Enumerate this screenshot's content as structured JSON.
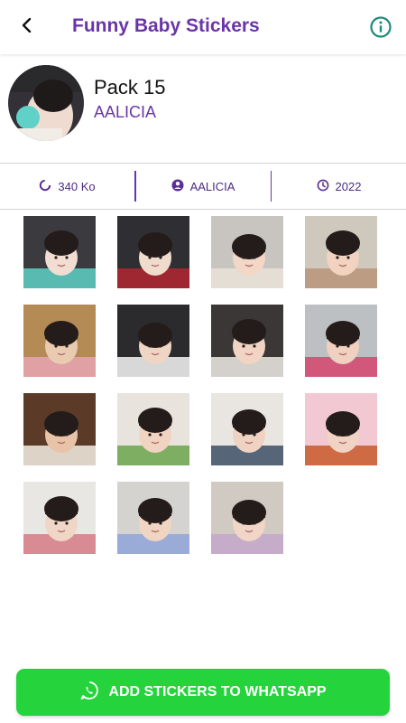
{
  "appbar": {
    "title": "Funny Baby Stickers",
    "back_icon": "back-arrow-icon",
    "info_icon": "info-icon",
    "accent": "#6a35a8"
  },
  "pack": {
    "name": "Pack 15",
    "author": "AALICIA"
  },
  "meta": {
    "size": "340 Ko",
    "author": "AALICIA",
    "year": "2022"
  },
  "stickers": [
    {
      "label": "sticker-1",
      "bg": "#3b3a3f",
      "subject": "#f1ddd2",
      "accent": "#5fd1c7"
    },
    {
      "label": "sticker-2",
      "bg": "#2f2f33",
      "subject": "#f0dccd",
      "accent": "#b32631"
    },
    {
      "label": "sticker-3",
      "bg": "#c8c5c1",
      "subject": "#f2d6c6",
      "accent": "#e9e2d8"
    },
    {
      "label": "sticker-4",
      "bg": "#cfc8bd",
      "subject": "#f1d3c0",
      "accent": "#b89478"
    },
    {
      "label": "sticker-5",
      "bg": "#b48a55",
      "subject": "#e9cbb2",
      "accent": "#e8a4b4"
    },
    {
      "label": "sticker-6",
      "bg": "#2b2b2d",
      "subject": "#efd5c4",
      "accent": "#f7f7f7"
    },
    {
      "label": "sticker-7",
      "bg": "#3a3736",
      "subject": "#f1d4c3",
      "accent": "#f0ece6"
    },
    {
      "label": "sticker-8",
      "bg": "#bcc0c3",
      "subject": "#f0d0c0",
      "accent": "#d5456e"
    },
    {
      "label": "sticker-9",
      "bg": "#5b3b28",
      "subject": "#e8c3a7",
      "accent": "#f6eee3"
    },
    {
      "label": "sticker-10",
      "bg": "#e8e3dc",
      "subject": "#f1d3c1",
      "accent": "#6aa54b"
    },
    {
      "label": "sticker-11",
      "bg": "#e9e6e1",
      "subject": "#f0d2c2",
      "accent": "#3d4e66"
    },
    {
      "label": "sticker-12",
      "bg": "#f2c9d2",
      "subject": "#f0d3c4",
      "accent": "#c8592b"
    },
    {
      "label": "sticker-13",
      "bg": "#e9e7e3",
      "subject": "#f0d6c6",
      "accent": "#d67a86"
    },
    {
      "label": "sticker-14",
      "bg": "#d5d3cf",
      "subject": "#f0d5c3",
      "accent": "#8fa3d8"
    },
    {
      "label": "sticker-15",
      "bg": "#d0cac2",
      "subject": "#f1d5c6",
      "accent": "#c3a7c9"
    }
  ],
  "add_button": {
    "label": "ADD STICKERS TO WHATSAPP",
    "icon": "whatsapp-icon",
    "color": "#25d33c"
  }
}
